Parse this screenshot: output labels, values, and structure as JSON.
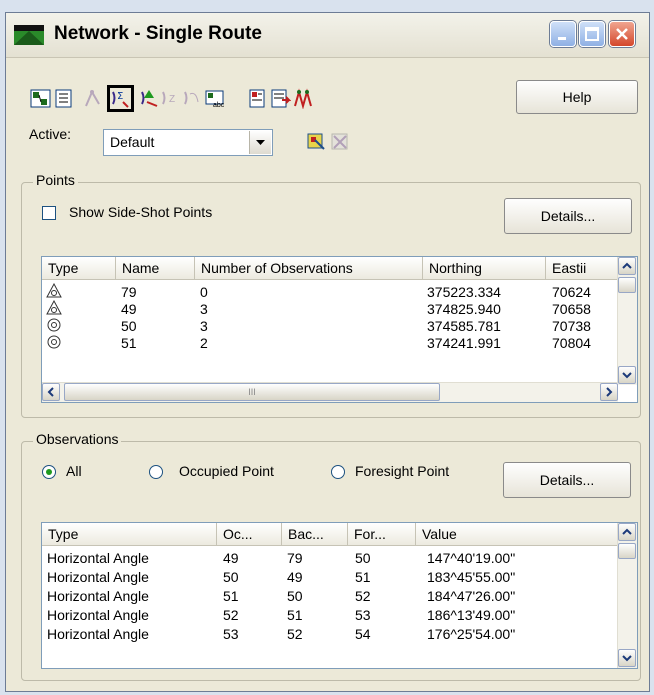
{
  "window": {
    "title": "Network - Single Route"
  },
  "toolbar": {
    "help_label": "Help"
  },
  "active": {
    "label": "Active:",
    "value": "Default"
  },
  "points": {
    "group_label": "Points",
    "show_sideshot_label": "Show Side-Shot Points",
    "details_label": "Details...",
    "columns": [
      "Type",
      "Name",
      "Number of Observations",
      "Northing",
      "Eastii"
    ],
    "rows": [
      {
        "name": "79",
        "obs": "0",
        "northing": "375223.334",
        "easting": "70624"
      },
      {
        "name": "49",
        "obs": "3",
        "northing": "374825.940",
        "easting": "70658"
      },
      {
        "name": "50",
        "obs": "3",
        "northing": "374585.781",
        "easting": "70738"
      },
      {
        "name": "51",
        "obs": "2",
        "northing": "374241.991",
        "easting": "70804"
      }
    ],
    "hscroll_grip": "III"
  },
  "observations": {
    "group_label": "Observations",
    "radio_all": "All",
    "radio_occupied": "Occupied Point",
    "radio_foresight": "Foresight Point",
    "details_label": "Details...",
    "columns": [
      "Type",
      "Oc...",
      "Bac...",
      "For...",
      "Value"
    ],
    "rows": [
      {
        "type": "Horizontal Angle",
        "oc": "49",
        "bac": "79",
        "for": "50",
        "value": "147^40'19.00\""
      },
      {
        "type": "Horizontal Angle",
        "oc": "50",
        "bac": "49",
        "for": "51",
        "value": "183^45'55.00\""
      },
      {
        "type": "Horizontal Angle",
        "oc": "51",
        "bac": "50",
        "for": "52",
        "value": "184^47'26.00\""
      },
      {
        "type": "Horizontal Angle",
        "oc": "52",
        "bac": "51",
        "for": "53",
        "value": "186^13'49.00\""
      },
      {
        "type": "Horizontal Angle",
        "oc": "53",
        "bac": "52",
        "for": "54",
        "value": "176^25'54.00\""
      }
    ]
  }
}
